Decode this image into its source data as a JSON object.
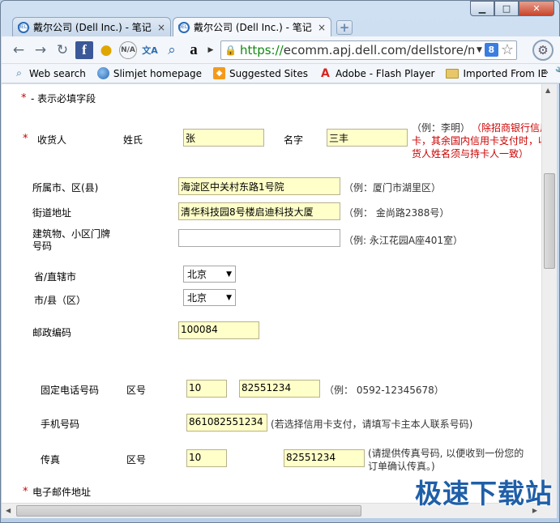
{
  "window": {
    "minimize": "▁",
    "maximize": "□",
    "close": "✕"
  },
  "tabs": [
    {
      "favicon": "DELL",
      "label": "戴尔公司 (Dell Inc.) - 笔记",
      "close": "×"
    },
    {
      "favicon": "DELL",
      "label": "戴尔公司 (Dell Inc.) - 笔记",
      "close": "×"
    }
  ],
  "newtab": "+",
  "toolbar": {
    "back": "←",
    "forward": "→",
    "reload": "↻",
    "url_scheme": "https://",
    "url_rest": "ecomm.apj.dell.com/dellstore/m",
    "search_engine": "8",
    "star": "☆",
    "icons": [
      "facebook-icon",
      "lightbulb-icon",
      "nia-icon",
      "translate-icon",
      "zoom-icon",
      "amazon-icon"
    ]
  },
  "bookmarks": [
    {
      "label": "Web search",
      "icon": "search-icon"
    },
    {
      "label": "Slimjet homepage",
      "icon": "globe-icon"
    },
    {
      "label": "Suggested Sites",
      "icon": "suggested-sites-icon"
    },
    {
      "label": "Adobe - Flash Player",
      "icon": "adobe-icon"
    },
    {
      "label": "Imported From IE",
      "icon": "folder-icon"
    }
  ],
  "bookmarks_more": "»",
  "form": {
    "required_note": "- 表示必填字段",
    "required_mark": "*",
    "recipient_label": "收货人",
    "surname_label": "姓氏",
    "surname_value": "张",
    "givenname_label": "名字",
    "givenname_value": "三丰",
    "name_hint_example": "（例：李明）",
    "name_hint_red1": "（除招商银行信用",
    "name_hint_red2": "卡，其余国内信用卡支付时，收",
    "name_hint_red3": "货人姓名须与持卡人一致）",
    "district_label": "所属市、区(县)",
    "district_value": "海淀区中关村东路1号院",
    "district_hint": "（例：厦门市湖里区）",
    "street_label": "街道地址",
    "street_value": "清华科技园8号楼启迪科技大厦",
    "street_hint": "（例：  金尚路2388号）",
    "building_label_1": "建筑物、小区门牌",
    "building_label_2": "号码",
    "building_value": "",
    "building_hint": "（例: 永江花园A座401室）",
    "province_label": "省/直辖市",
    "province_value": "北京",
    "city_label": "市/县（区）",
    "city_value": "北京",
    "zip_label": "邮政编码",
    "zip_value": "100084",
    "phone_label": "固定电话号码",
    "area_code_label": "区号",
    "phone_area": "10",
    "phone_number": "82551234",
    "phone_hint": "（例：  0592-12345678）",
    "mobile_label": "手机号码",
    "mobile_value": "861082551234",
    "mobile_hint": "(若选择信用卡支付，请填写卡主本人联系号码)",
    "fax_label": "传真",
    "fax_area_label": "区号",
    "fax_area": "10",
    "fax_number": "82551234",
    "fax_hint_1": "(请提供传真号码, 以便收到一份您的",
    "fax_hint_2": "订单确认传真。)",
    "email_label": "电子邮件地址"
  },
  "watermark": "极速下载站"
}
